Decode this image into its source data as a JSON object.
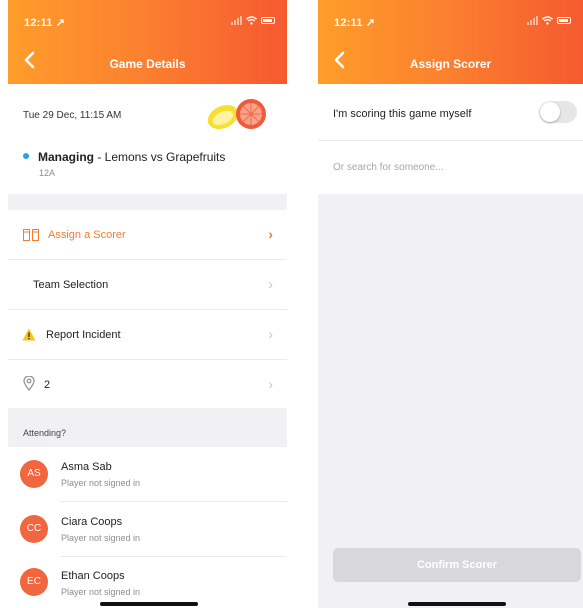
{
  "left": {
    "status_time": "12:11 ↗",
    "title": "Game Details",
    "game": {
      "date": "Tue 29 Dec, 11:15 AM",
      "role": "Managing",
      "matchup": " - Lemons vs Grapefruits",
      "team": "12A"
    },
    "menu": [
      {
        "label": "Assign a Scorer",
        "icon": "scorer-icon"
      },
      {
        "label": "Team Selection"
      },
      {
        "label": "Report Incident",
        "icon": "warning-icon"
      },
      {
        "label": "2",
        "icon": "location-pin-icon"
      }
    ],
    "attending_label": "Attending?",
    "players": [
      {
        "initials": "AS",
        "name": "Asma Sab",
        "status": "Player not signed in"
      },
      {
        "initials": "CC",
        "name": "Ciara Coops",
        "status": "Player not signed in"
      },
      {
        "initials": "EC",
        "name": "Ethan Coops",
        "status": "Player not signed in"
      }
    ]
  },
  "right": {
    "status_time": "12:11 ↗",
    "title": "Assign Scorer",
    "self_scoring_label": "I'm scoring this game myself",
    "self_scoring_on": false,
    "search_placeholder": "Or search for someone...",
    "confirm_label": "Confirm Scorer"
  },
  "colors": {
    "header_start": "#ff9d2a",
    "header_end": "#f55a2f",
    "accent": "#f57c2b",
    "avatar": "#f1653f",
    "managing_dot": "#1ba7e6",
    "warning": "#f5c518"
  }
}
